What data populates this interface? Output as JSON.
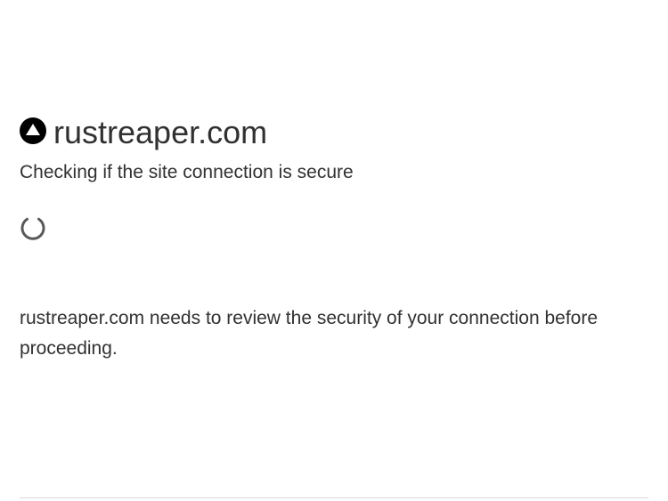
{
  "header": {
    "site_name": "rustreaper.com",
    "icon": "warning-triangle-icon",
    "subtitle": "Checking if the site connection is secure"
  },
  "status": {
    "spinner_icon": "loading-spinner-icon"
  },
  "body": {
    "message": "rustreaper.com needs to review the security of your connection before proceeding."
  },
  "colors": {
    "text": "#313131",
    "icon": "#000000",
    "divider": "#d9d9d9",
    "spinner": "#595959"
  }
}
